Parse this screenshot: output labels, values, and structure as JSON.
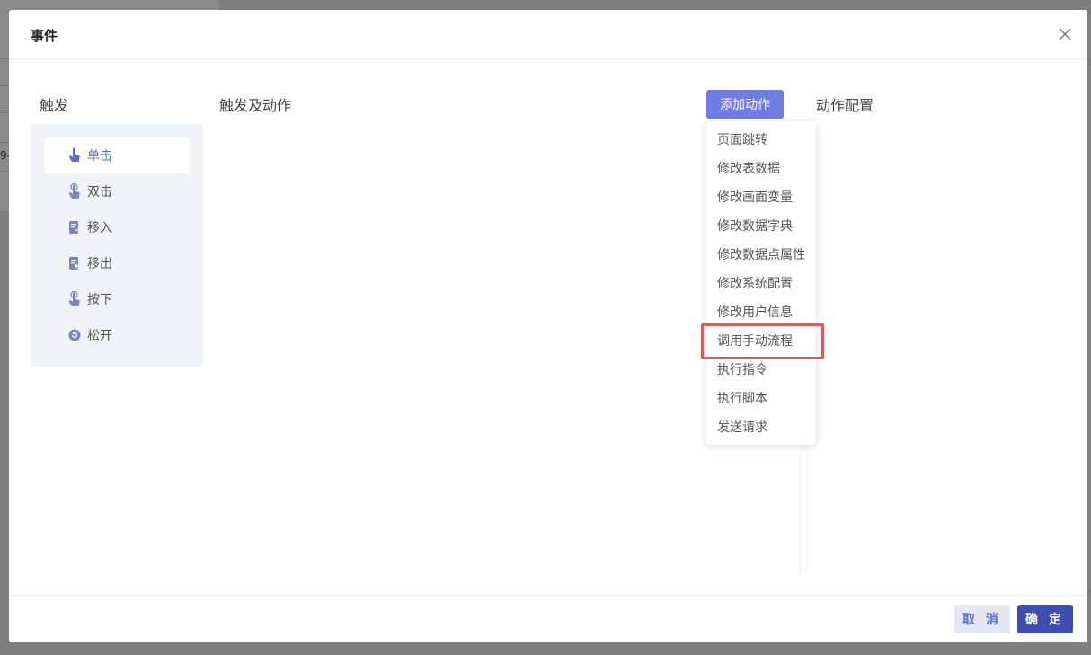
{
  "background": {
    "fragment_text": "9-"
  },
  "modal": {
    "title": "事件",
    "close_icon": "close-icon"
  },
  "columns": {
    "trigger": "触发",
    "flow": "触发及动作",
    "config": "动作配置"
  },
  "triggers": [
    {
      "label": "单击",
      "icon": "tap-icon",
      "active": true
    },
    {
      "label": "双击",
      "icon": "double-tap-icon",
      "active": false
    },
    {
      "label": "移入",
      "icon": "move-in-icon",
      "active": false
    },
    {
      "label": "移出",
      "icon": "move-out-icon",
      "active": false
    },
    {
      "label": "按下",
      "icon": "press-icon",
      "active": false
    },
    {
      "label": "松开",
      "icon": "release-icon",
      "active": false
    }
  ],
  "add_action": {
    "label": "添加动作",
    "items": [
      "页面跳转",
      "修改表数据",
      "修改画面变量",
      "修改数据字典",
      "修改数据点属性",
      "修改系统配置",
      "修改用户信息",
      "调用手动流程",
      "执行指令",
      "执行脚本",
      "发送请求"
    ],
    "highlighted_index": 7
  },
  "footer": {
    "cancel": "取 消",
    "ok": "确 定"
  },
  "colors": {
    "accent": "#6f7ce3",
    "active_text": "#5b6bd6",
    "ok_button": "#3f4cb0",
    "highlight": "#e05a5a"
  }
}
